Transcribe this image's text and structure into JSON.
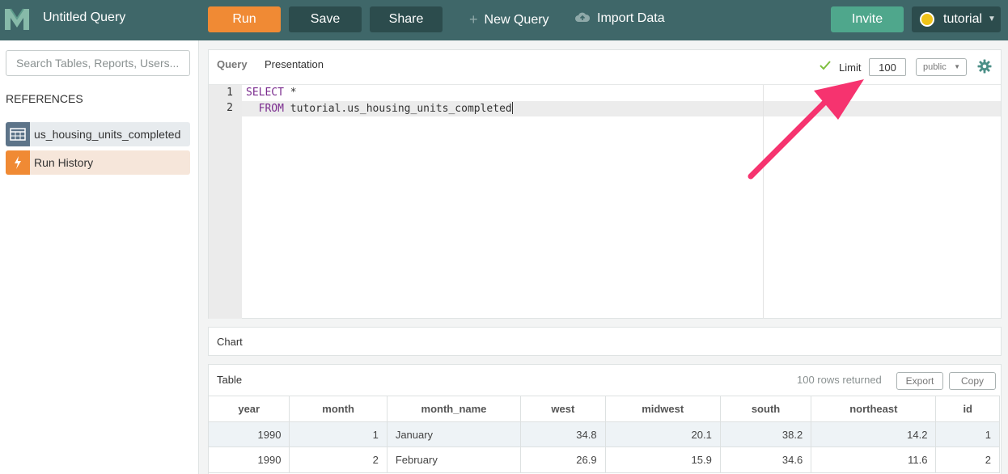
{
  "app": {
    "title": "Untitled Query",
    "colors": {
      "topbar": "#3f6769",
      "run": "#f08a34",
      "dark_button": "#2c4c4d",
      "invite": "#4fa78c",
      "arrow": "#f6336f"
    }
  },
  "toolbar": {
    "run_label": "Run",
    "save_label": "Save",
    "share_label": "Share",
    "new_query_label": "New Query",
    "import_label": "Import Data",
    "invite_label": "Invite",
    "user_name": "tutorial"
  },
  "sidebar": {
    "search_placeholder": "Search Tables, Reports, Users...",
    "references_heading": "REFERENCES",
    "items": [
      {
        "label": "us_housing_units_completed",
        "icon": "table-icon"
      },
      {
        "label": "Run History",
        "icon": "lightning-icon"
      }
    ]
  },
  "query_panel": {
    "tabs": [
      "Query",
      "Presentation"
    ],
    "limit_label": "Limit",
    "limit_value": "100",
    "schema_value": "public",
    "editor": {
      "line_numbers": [
        "1",
        "2"
      ],
      "line1": {
        "keyword": "SELECT",
        "rest": " *"
      },
      "line2": {
        "indent": "  ",
        "keyword": "FROM",
        "rest": " tutorial.us_housing_units_completed"
      }
    }
  },
  "chart_panel": {
    "title": "Chart"
  },
  "table_panel": {
    "title": "Table",
    "rows_returned": "100 rows returned",
    "export_label": "Export",
    "copy_label": "Copy",
    "columns": [
      "year",
      "month",
      "month_name",
      "west",
      "midwest",
      "south",
      "northeast",
      "id"
    ],
    "rows": [
      [
        "1990",
        "1",
        "January",
        "34.8",
        "20.1",
        "38.2",
        "14.2",
        "1"
      ],
      [
        "1990",
        "2",
        "February",
        "26.9",
        "15.9",
        "34.6",
        "11.6",
        "2"
      ]
    ]
  }
}
